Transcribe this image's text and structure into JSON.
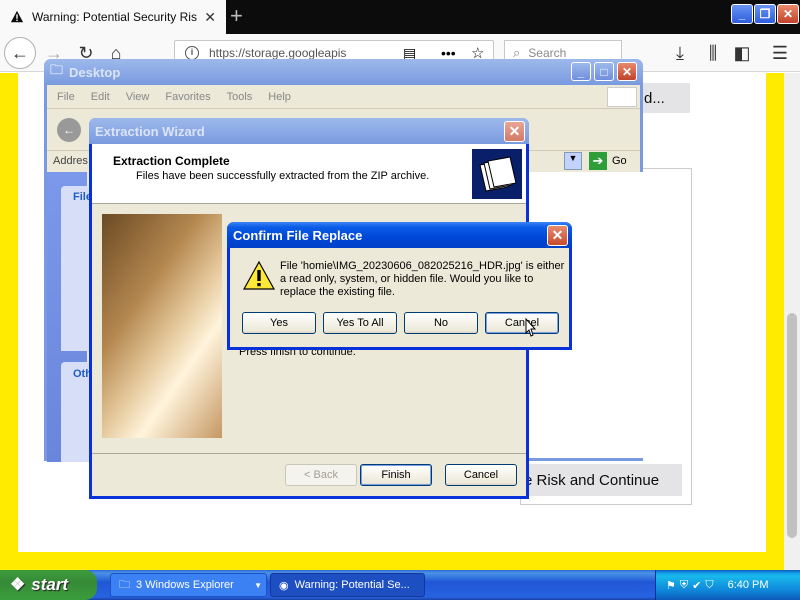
{
  "browser": {
    "tab_title": "Warning: Potential Security Risk A",
    "tab_close": "✕",
    "new_tab": "+",
    "url": "https://storage.googleapis",
    "search_placeholder": "Search",
    "page_button_top": "d...",
    "page_button_bottom": "e Risk and Continue"
  },
  "desktop_window": {
    "title": "Desktop",
    "menu": [
      "File",
      "Edit",
      "View",
      "Favorites",
      "Tools",
      "Help"
    ],
    "address_label": "Addres",
    "go_label": "Go",
    "task_header_1": "File",
    "task_header_2": "Oth"
  },
  "wizard": {
    "title": "Extraction Wizard",
    "heading": "Extraction Complete",
    "subheading": "Files have been successfully extracted from the ZIP archive.",
    "finish_text": "Press finish to continue.",
    "back_label": "< Back",
    "finish_label": "Finish",
    "cancel_label": "Cancel"
  },
  "dialog": {
    "title": "Confirm File Replace",
    "message": "File 'homie\\IMG_20230606_082025216_HDR.jpg' is either a read only, system, or hidden file.  Would you like to replace the existing file.",
    "buttons": {
      "yes": "Yes",
      "yes_to_all": "Yes To All",
      "no": "No",
      "cancel": "Cancel"
    }
  },
  "taskbar": {
    "start_label": "start",
    "explorer_label": "3 Windows Explorer",
    "firefox_label": "Warning: Potential Se...",
    "clock": "6:40 PM"
  },
  "colors": {
    "xp_blue": "#0046d8",
    "yellow_frame": "#ffeb00",
    "start_green": "#3a9b3a"
  }
}
